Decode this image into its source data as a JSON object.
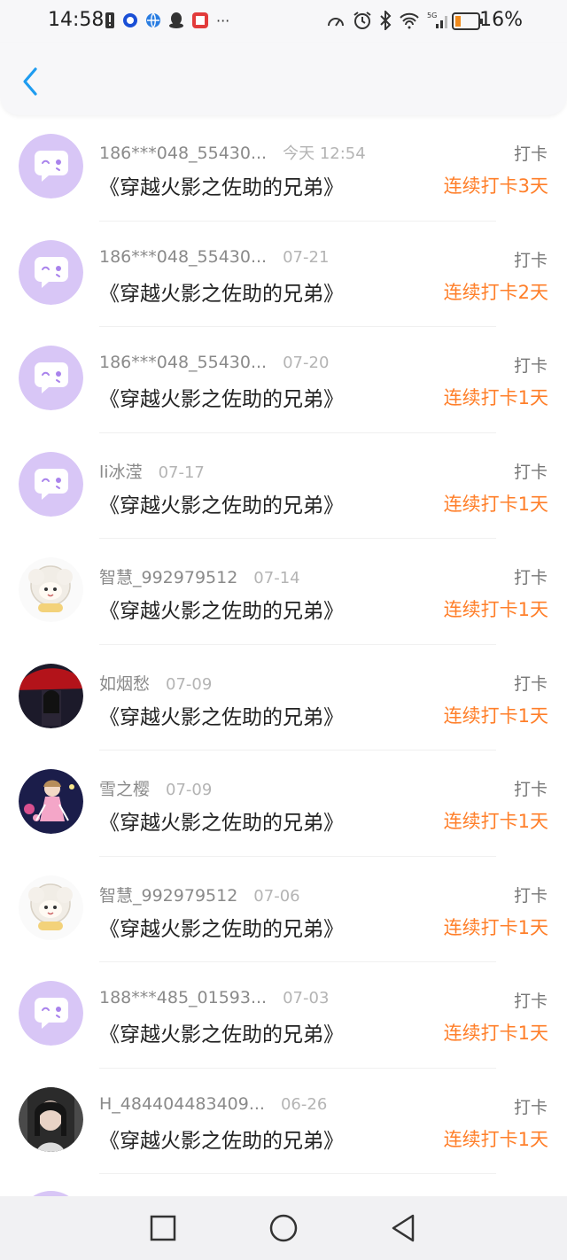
{
  "status_bar": {
    "time": "14:58",
    "battery_text": "16%",
    "network": "5G",
    "left_icons": [
      "alert-icon",
      "circle-app-icon",
      "globe-app-icon",
      "qq-icon",
      "reader-app-icon",
      "more-dots-icon"
    ],
    "right_icons": [
      "speedometer-icon",
      "alarm-icon",
      "bluetooth-icon",
      "wifi-icon",
      "signal-icon",
      "battery-icon"
    ]
  },
  "header": {
    "back_icon": "chevron-left-icon",
    "accent": "#1e9cf0"
  },
  "colors": {
    "streak": "#ff7f2a",
    "avatar_bg": "#d8c6f6",
    "avatar_icon": "#a983ec"
  },
  "records": [
    {
      "user": "186***048_55430...",
      "date": "今天 12:54",
      "book": "《穿越火影之佐助的兄弟》",
      "action": "打卡",
      "streak": "连续打卡3天",
      "avatar": "default"
    },
    {
      "user": "186***048_55430...",
      "date": "07-21",
      "book": "《穿越火影之佐助的兄弟》",
      "action": "打卡",
      "streak": "连续打卡2天",
      "avatar": "default"
    },
    {
      "user": "186***048_55430...",
      "date": "07-20",
      "book": "《穿越火影之佐助的兄弟》",
      "action": "打卡",
      "streak": "连续打卡1天",
      "avatar": "default"
    },
    {
      "user": "li冰滢",
      "date": "07-17",
      "book": "《穿越火影之佐助的兄弟》",
      "action": "打卡",
      "streak": "连续打卡1天",
      "avatar": "default"
    },
    {
      "user": "智慧_992979512",
      "date": "07-14",
      "book": "《穿越火影之佐助的兄弟》",
      "action": "打卡",
      "streak": "连续打卡1天",
      "avatar": "sheep"
    },
    {
      "user": "如烟愁",
      "date": "07-09",
      "book": "《穿越火影之佐助的兄弟》",
      "action": "打卡",
      "streak": "连续打卡1天",
      "avatar": "umbrella"
    },
    {
      "user": "雪之樱",
      "date": "07-09",
      "book": "《穿越火影之佐助的兄弟》",
      "action": "打卡",
      "streak": "连续打卡1天",
      "avatar": "anime"
    },
    {
      "user": "智慧_992979512",
      "date": "07-06",
      "book": "《穿越火影之佐助的兄弟》",
      "action": "打卡",
      "streak": "连续打卡1天",
      "avatar": "sheep"
    },
    {
      "user": "188***485_01593...",
      "date": "07-03",
      "book": "《穿越火影之佐助的兄弟》",
      "action": "打卡",
      "streak": "连续打卡1天",
      "avatar": "default"
    },
    {
      "user": "H_484404483409...",
      "date": "06-26",
      "book": "《穿越火影之佐助的兄弟》",
      "action": "打卡",
      "streak": "连续打卡1天",
      "avatar": "photo"
    }
  ],
  "bottom_nav": [
    "recent-apps-icon",
    "home-icon",
    "back-icon"
  ]
}
